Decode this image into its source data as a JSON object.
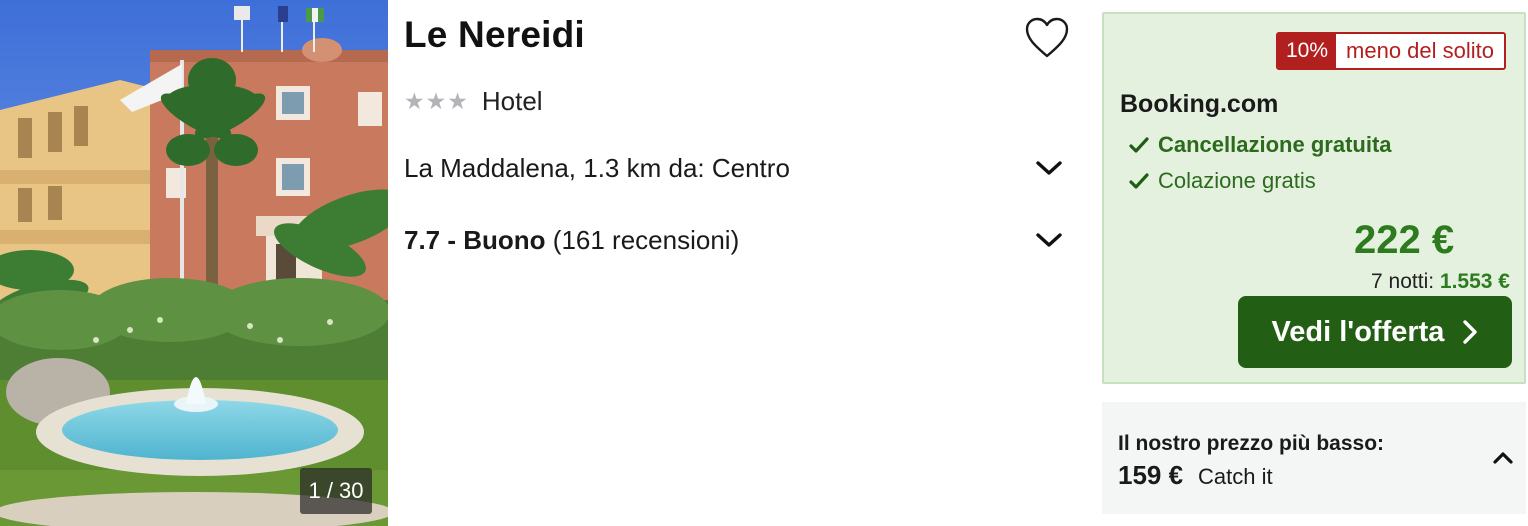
{
  "hotel": {
    "name": "Le Nereidi",
    "stars": 3,
    "type": "Hotel",
    "location": "La Maddalena, 1.3 km da: Centro",
    "rating_score": "7.7 - Buono",
    "rating_count": "(161 recensioni)",
    "favorite_icon": "heart-icon"
  },
  "gallery": {
    "counter": "1 / 30"
  },
  "offer": {
    "badge_percent": "10%",
    "badge_text": "meno del solito",
    "provider": "Booking.com",
    "features": [
      "Cancellazione gratuita",
      "Colazione gratis"
    ],
    "price": "222 €",
    "nights_label": "7 notti:",
    "nights_total": "1.553 €",
    "cta_label": "Vedi l'offerta",
    "colors": {
      "accent": "#225e14",
      "price": "#2d7a1f",
      "badge": "#b21f1f",
      "panel": "#e4f1df"
    }
  },
  "lowest": {
    "label": "Il nostro prezzo più basso:",
    "price": "159 €",
    "provider": "Catch it"
  }
}
